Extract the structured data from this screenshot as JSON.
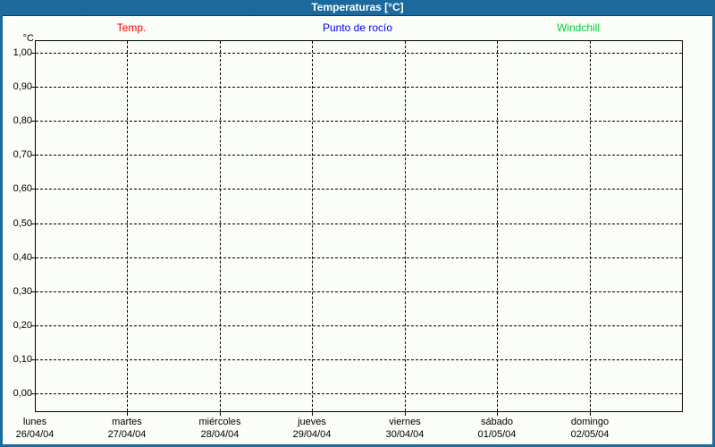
{
  "window": {
    "title": "Temperaturas [°C]"
  },
  "legend": {
    "items": [
      {
        "label": "Temp.",
        "color": "#ff0000"
      },
      {
        "label": "Punto de rocío",
        "color": "#0000ff"
      },
      {
        "label": "Windchill",
        "color": "#00cc33"
      }
    ]
  },
  "chart_data": {
    "type": "line",
    "title": "Temperaturas [°C]",
    "unit_label": "°C",
    "grid": "dashed",
    "legend_position": "top",
    "y_axis": {
      "min": 0.0,
      "max": 1.0,
      "step": 0.1,
      "tick_labels": [
        "1,00",
        "0,90",
        "0,80",
        "0,70",
        "0,60",
        "0,50",
        "0,40",
        "0,30",
        "0,20",
        "0,10",
        "0,00"
      ]
    },
    "x_axis": {
      "tick_labels": [
        {
          "weekday": "lunes",
          "date": "26/04/04"
        },
        {
          "weekday": "martes",
          "date": "27/04/04"
        },
        {
          "weekday": "miércoles",
          "date": "28/04/04"
        },
        {
          "weekday": "jueves",
          "date": "29/04/04"
        },
        {
          "weekday": "viernes",
          "date": "30/04/04"
        },
        {
          "weekday": "sábado",
          "date": "01/05/04"
        },
        {
          "weekday": "domingo",
          "date": "02/05/04"
        }
      ]
    },
    "series": [
      {
        "name": "Temp.",
        "color": "#ff0000",
        "values": []
      },
      {
        "name": "Punto de rocío",
        "color": "#0000ff",
        "values": []
      },
      {
        "name": "Windchill",
        "color": "#00cc33",
        "values": []
      }
    ]
  },
  "colors": {
    "titlebar_bg": "#1c6a9e",
    "titlebar_text": "#ffffff",
    "titlebar_underline": "#0b3b5f",
    "frame": "#1c6a9e",
    "page_bg": "#fbfdf8",
    "grid": "#000000",
    "axis": "#000000"
  }
}
